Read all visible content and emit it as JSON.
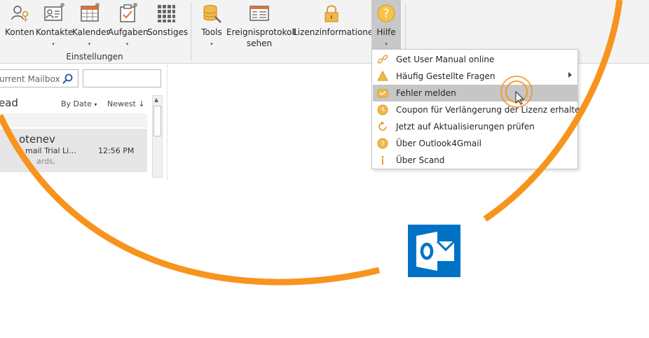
{
  "ribbon": {
    "buttons": {
      "konten": "Konten",
      "kontakte": "Kontakte",
      "kalender": "Kalender",
      "aufgaben": "Aufgaben",
      "sonstiges": "Sonstiges",
      "tools": "Tools",
      "ereignis_line1": "Ereignisprotokoll",
      "ereignis_line2": "sehen",
      "lizenz": "Lizenzinformationen",
      "hilfe": "Hilfe"
    },
    "group_label": "Einstellungen",
    "dropdown_glyph": "▾"
  },
  "mail_list": {
    "search_placeholder": "urrent Mailbox",
    "heading": "ead",
    "sort_by": "By Date",
    "sort_order": "Newest",
    "sort_arrow": "↓",
    "scroll_up_glyph": "▲",
    "item": {
      "sender": "otenev",
      "subject": "mail Trial Li...",
      "time": "12:56 PM",
      "preview": "ards,"
    }
  },
  "help_menu": {
    "items": [
      {
        "label": "Get User Manual online",
        "icon": "link-icon"
      },
      {
        "label": "Häufig Gestellte Fragen",
        "icon": "warning-icon",
        "has_submenu": true
      },
      {
        "label": "Fehler melden",
        "icon": "bug-report-icon",
        "highlighted": true
      },
      {
        "label": "Coupon für Verlängerung der Lizenz erhalten",
        "icon": "clock-icon"
      },
      {
        "label": "Jetzt auf Aktualisierungen prüfen",
        "icon": "refresh-icon"
      },
      {
        "label": "Über Outlook4Gmail",
        "icon": "question-icon"
      },
      {
        "label": "Über Scand",
        "icon": "info-icon"
      }
    ]
  },
  "colors": {
    "accent_orange": "#f7941d",
    "outlook_blue": "#0072c6",
    "menu_highlight": "#c6c6c6",
    "ribbon_bg": "#f3f3f3"
  }
}
